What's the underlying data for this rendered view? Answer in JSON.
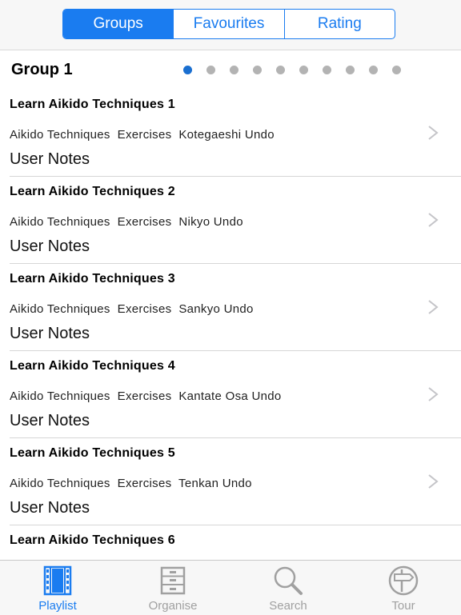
{
  "segments": [
    {
      "label": "Groups",
      "active": true
    },
    {
      "label": "Favourites",
      "active": false
    },
    {
      "label": "Rating",
      "active": false
    }
  ],
  "group": {
    "title": "Group 1",
    "page_count": 10,
    "current_page": 1
  },
  "items": [
    {
      "title": "Learn Aikido Techniques 1",
      "subtitle": "Aikido Techniques  Exercises  Kotegaeshi Undo",
      "notes": "User Notes"
    },
    {
      "title": "Learn Aikido Techniques 2",
      "subtitle": "Aikido Techniques  Exercises  Nikyo Undo",
      "notes": "User Notes"
    },
    {
      "title": "Learn Aikido Techniques 3",
      "subtitle": "Aikido Techniques  Exercises  Sankyo Undo",
      "notes": "User Notes"
    },
    {
      "title": "Learn Aikido Techniques 4",
      "subtitle": "Aikido Techniques  Exercises  Kantate Osa Undo",
      "notes": "User Notes"
    },
    {
      "title": "Learn Aikido Techniques 5",
      "subtitle": "Aikido Techniques  Exercises  Tenkan Undo",
      "notes": "User Notes"
    },
    {
      "title": "Learn Aikido Techniques 6",
      "subtitle": "",
      "notes": ""
    }
  ],
  "tabs": [
    {
      "label": "Playlist",
      "icon": "film-strip-icon",
      "active": true
    },
    {
      "label": "Organise",
      "icon": "cabinet-icon",
      "active": false
    },
    {
      "label": "Search",
      "icon": "magnifier-icon",
      "active": false
    },
    {
      "label": "Tour",
      "icon": "signpost-icon",
      "active": false
    }
  ],
  "colors": {
    "accent": "#1a7cf0",
    "inactive": "#a0a0a0",
    "dot_inactive": "#b3b3b3",
    "dot_active": "#1a6fd0"
  }
}
